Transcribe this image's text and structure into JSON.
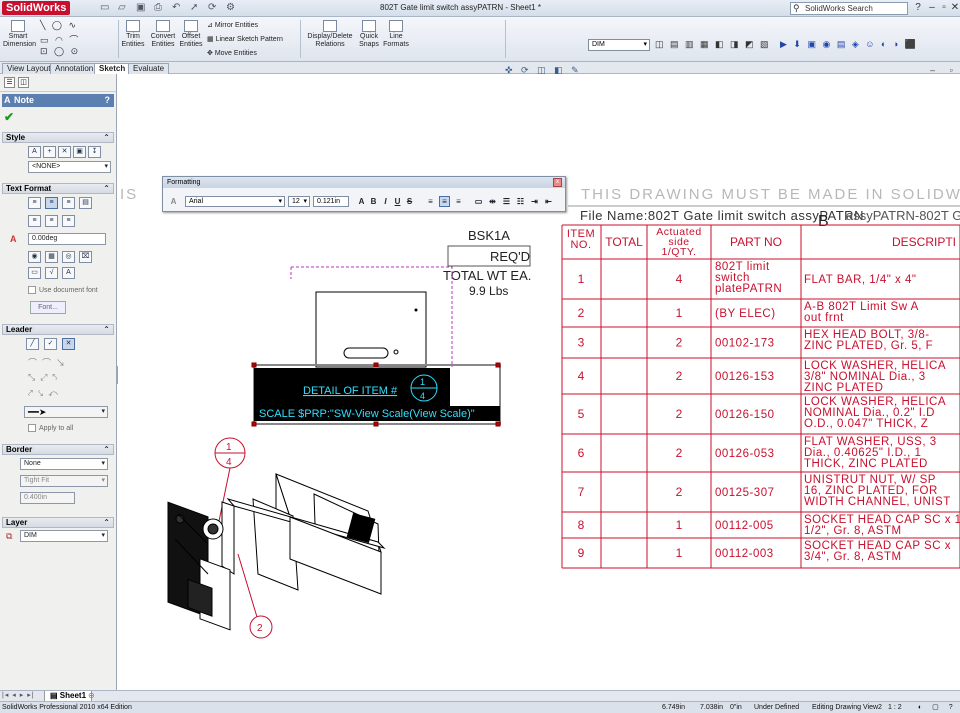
{
  "app": {
    "name": "SolidWorks",
    "window_title": "802T Gate limit switch assyPATRN - Sheet1 *",
    "search_placeholder": "SolidWorks Search"
  },
  "ribbon": {
    "smart_dimension": "Smart Dimension",
    "trim": "Trim Entities",
    "convert": "Convert Entities",
    "offset": "Offset Entities",
    "mirror": "Mirror Entities",
    "linear_pattern": "Linear Sketch Pattern",
    "move": "Move Entities",
    "display_delete": "Display/Delete Relations",
    "quick_snaps": "Quick Snaps",
    "line_formats": "Line Formats",
    "layer_select": "DIM"
  },
  "tabs": [
    "View Layout",
    "Annotation",
    "Sketch",
    "Evaluate"
  ],
  "active_tab": "Sketch",
  "panel": {
    "title": "Note",
    "help": "?",
    "style": {
      "header": "Style",
      "select": "<NONE>"
    },
    "text_format": {
      "header": "Text Format",
      "angle": "0.00deg",
      "use_doc_font": "Use document font",
      "font_btn": "Font..."
    },
    "leader": {
      "header": "Leader",
      "apply_all": "Apply to all"
    },
    "border": {
      "header": "Border",
      "style": "None",
      "size": "Tight Fit",
      "value": "0.400in"
    },
    "layer": {
      "header": "Layer",
      "select": "DIM"
    }
  },
  "formatting": {
    "title": "Formatting",
    "font": "Arial",
    "size": "12",
    "height": "0.121in"
  },
  "drawing": {
    "banner": "THIS DRAWING MUST BE MADE IN SOLIDW",
    "banner_left": "IS",
    "file_line": "File Name:802T Gate limit switch assyPATRN",
    "file_overlap": "assyPATRN-802T Gate",
    "title_block": {
      "bsk": "BSK1A",
      "reqd": "REQ'D",
      "total_wt": "TOTAL WT EA.",
      "lbs": "9.9 Lbs"
    },
    "detail": {
      "label": "DETAIL OF ITEM #",
      "balloon_top": "1",
      "balloon_bot": "4",
      "scale": "SCALE $PRP:\"SW-View Scale(View Scale)\""
    },
    "balloon1": {
      "top": "1",
      "bottom": "4"
    },
    "balloon2": "2",
    "bom": {
      "headers": {
        "item": "ITEM NO.",
        "total": "TOTAL",
        "qty": "Actuated side 1/QTY.",
        "part": "PART NO",
        "desc": "DESCRIPTI"
      },
      "rows": [
        {
          "item": "1",
          "qty": "4",
          "part": "802T limit switch platePATRN",
          "desc": "FLAT BAR, 1/4\" x 4\""
        },
        {
          "item": "2",
          "qty": "1",
          "part": "(BY ELEC)",
          "desc": "A-B 802T Limit Sw A out frnt"
        },
        {
          "item": "3",
          "qty": "2",
          "part": "00102-173",
          "desc": "HEX HEAD BOLT, 3/8- ZINC PLATED, Gr. 5, F"
        },
        {
          "item": "4",
          "qty": "2",
          "part": "00126-153",
          "desc": "LOCK WASHER, HELICA 3/8\" NOMINAL Dia., 3 ZINC PLATED"
        },
        {
          "item": "5",
          "qty": "2",
          "part": "00126-150",
          "desc": "LOCK WASHER, HELICA NOMINAL Dia., 0.2\" I.D O.D., 0.047\" THICK, Z"
        },
        {
          "item": "6",
          "qty": "2",
          "part": "00126-053",
          "desc": "FLAT WASHER, USS, 3 Dia., 0.40625\" I.D., 1 THICK, ZINC PLATED"
        },
        {
          "item": "7",
          "qty": "2",
          "part": "00125-307",
          "desc": "UNISTRUT NUT, W/ SP 16, ZINC PLATED, FOR WIDTH CHANNEL, UNIST"
        },
        {
          "item": "8",
          "qty": "1",
          "part": "00112-005",
          "desc": "SOCKET HEAD CAP SC x 1 1/2\", Gr. 8, ASTM"
        },
        {
          "item": "9",
          "qty": "1",
          "part": "00112-003",
          "desc": "SOCKET HEAD CAP SC x 3/4\", Gr. 8, ASTM"
        }
      ]
    }
  },
  "sheet_tab": "Sheet1",
  "status": {
    "edition": "SolidWorks Professional 2010 x64 Edition",
    "x": "6.749in",
    "y": "7.038in",
    "z": "0\"in",
    "state": "Under Defined",
    "editing": "Editing Drawing View2",
    "scale": "1 : 2"
  },
  "colors": {
    "accent": "#5a7fb0",
    "bom_red": "#c8102e",
    "note_bg": "#000000",
    "note_text": "#2fe0ff"
  }
}
